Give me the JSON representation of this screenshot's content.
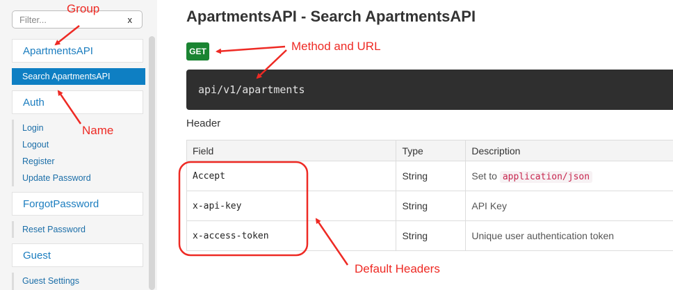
{
  "sidebar": {
    "filter": {
      "placeholder": "Filter...",
      "clear_label": "x"
    },
    "groups": [
      {
        "label": "ApartmentsAPI",
        "items": [
          "Search ApartmentsAPI"
        ]
      },
      {
        "label": "Auth",
        "items": [
          "Login",
          "Logout",
          "Register",
          "Update Password"
        ]
      },
      {
        "label": "ForgotPassword",
        "items": [
          "Reset Password"
        ]
      },
      {
        "label": "Guest",
        "items": [
          "Guest Settings"
        ]
      }
    ],
    "active_item": "Search ApartmentsAPI"
  },
  "main": {
    "title": "ApartmentsAPI - Search ApartmentsAPI",
    "method": "GET",
    "url": "api/v1/apartments",
    "section_title": "Header",
    "table": {
      "columns": [
        "Field",
        "Type",
        "Description"
      ],
      "rows": [
        {
          "field": "Accept",
          "type": "String",
          "description_prefix": "Set to",
          "description_code": "application/json"
        },
        {
          "field": "x-api-key",
          "type": "String",
          "description": "API Key"
        },
        {
          "field": "x-access-token",
          "type": "String",
          "description": "Unique user authentication token"
        }
      ]
    }
  },
  "annotations": {
    "group": "Group",
    "name": "Name",
    "method_and_url": "Method and URL",
    "default_headers": "Default Headers",
    "color": "#ee2a24"
  },
  "colors": {
    "accent": "#0e7fc3",
    "link": "#1b7dbf",
    "method_get": "#1a8432",
    "code_bg": "#2f2f2f"
  }
}
